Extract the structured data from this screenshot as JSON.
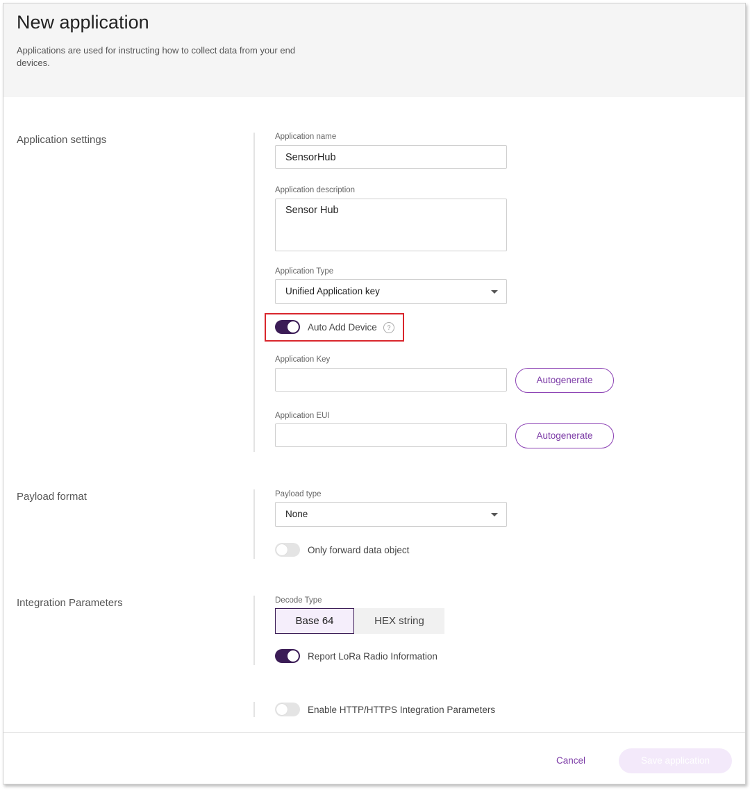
{
  "header": {
    "title": "New application",
    "subtitle": "Applications are used for instructing how to collect data from your end devices."
  },
  "sections": {
    "application_settings": "Application settings",
    "payload_format": "Payload format",
    "integration_parameters": "Integration Parameters"
  },
  "app_settings": {
    "name_label": "Application name",
    "name_value": "SensorHub",
    "description_label": "Application description",
    "description_value": "Sensor Hub",
    "type_label": "Application Type",
    "type_value": "Unified Application key",
    "auto_add_label": "Auto Add Device",
    "auto_add_on": true,
    "help_glyph": "?",
    "app_key_label": "Application Key",
    "app_key_value": "",
    "app_eui_label": "Application EUI",
    "app_eui_value": "",
    "autogenerate_label": "Autogenerate"
  },
  "payload": {
    "type_label": "Payload type",
    "type_value": "None",
    "only_forward_label": "Only forward data object",
    "only_forward_on": false
  },
  "integration": {
    "decode_label": "Decode Type",
    "decode_options": [
      "Base 64",
      "HEX string"
    ],
    "decode_selected": "Base 64",
    "report_lora_label": "Report LoRa Radio Information",
    "report_lora_on": true,
    "http_label": "Enable HTTP/HTTPS Integration Parameters",
    "http_on": false
  },
  "footer": {
    "cancel_label": "Cancel",
    "save_label": "Save application"
  },
  "colors": {
    "accent": "#7b3aa6",
    "toggle_on": "#3b1c56",
    "highlight": "#d9262c"
  }
}
